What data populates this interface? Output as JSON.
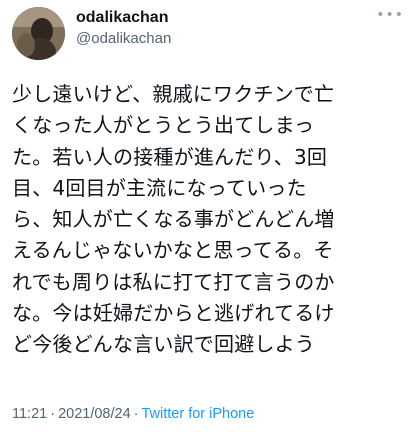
{
  "author": {
    "display_name": "odalikachan",
    "handle": "@odalikachan"
  },
  "more_icon": "more-options-icon",
  "tweet": {
    "lines": [
      "少し遠いけど、親戚にワクチンで亡",
      "くなった人がとうとう出てしまっ",
      "た。若い人の接種が進んだり、3回",
      "目、4回目が主流になっていった",
      "ら、知人が亡くなる事がどんどん増",
      "えるんじゃないかなと思ってる。そ",
      "れでも周りは私に打て打て言うのか",
      "な。今は妊婦だからと逃げれてるけ",
      "ど今後どんな言い訳で回避しよう"
    ]
  },
  "meta": {
    "time": "11:21",
    "date": "2021/08/24",
    "source": "Twitter for iPhone"
  },
  "colors": {
    "text": "#0f1419",
    "secondary": "#536471",
    "link": "#1d9bf0"
  }
}
